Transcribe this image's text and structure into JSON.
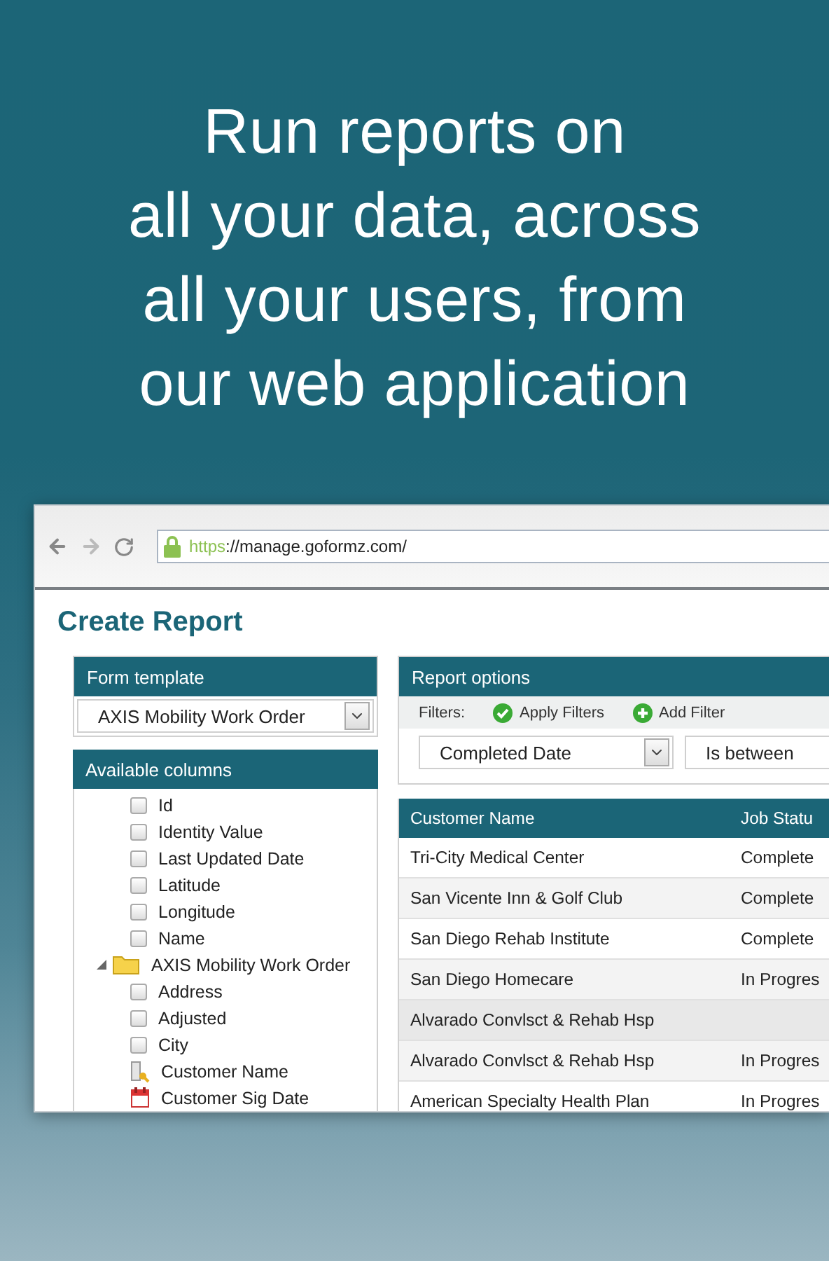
{
  "headline_lines": [
    "Run reports on",
    "all your data, across",
    "all your users, from",
    "our web application"
  ],
  "browser": {
    "url_scheme": "https",
    "url_rest": "://manage.goformz.com/"
  },
  "page_title": "Create Report",
  "form_template": {
    "title": "Form template",
    "value": "AXIS Mobility Work Order"
  },
  "available_columns": {
    "title": "Available columns",
    "items": [
      {
        "kind": "checkbox",
        "label": "Id",
        "checked": false
      },
      {
        "kind": "checkbox",
        "label": "Identity Value",
        "checked": false
      },
      {
        "kind": "checkbox",
        "label": "Last Updated Date",
        "checked": false
      },
      {
        "kind": "checkbox",
        "label": "Latitude",
        "checked": false
      },
      {
        "kind": "checkbox",
        "label": "Longitude",
        "checked": false
      },
      {
        "kind": "checkbox",
        "label": "Name",
        "checked": false
      },
      {
        "kind": "folder",
        "label": "AXIS Mobility Work Order",
        "expanded": true,
        "children": [
          {
            "kind": "checkbox",
            "label": "Address",
            "checked": false
          },
          {
            "kind": "checkbox",
            "label": "Adjusted",
            "checked": false
          },
          {
            "kind": "checkbox",
            "label": "City",
            "checked": false
          },
          {
            "kind": "key-field",
            "label": "Customer Name"
          },
          {
            "kind": "date-field",
            "label": "Customer Sig Date"
          }
        ]
      }
    ]
  },
  "report_options": {
    "title": "Report options",
    "filters_label": "Filters:",
    "apply_label": "Apply Filters",
    "add_label": "Add Filter",
    "field_select": "Completed Date",
    "operator_select": "Is between"
  },
  "table": {
    "columns": [
      "Customer Name",
      "Job Statu"
    ],
    "rows": [
      {
        "kind": "item",
        "cells": [
          "Tri-City Medical Center",
          "Complete"
        ]
      },
      {
        "kind": "item",
        "cells": [
          "San Vicente Inn & Golf Club",
          "Complete"
        ]
      },
      {
        "kind": "item",
        "cells": [
          "San Diego Rehab Institute",
          "Complete"
        ]
      },
      {
        "kind": "item",
        "cells": [
          "San Diego Homecare",
          "In Progres"
        ]
      },
      {
        "kind": "group",
        "cells": [
          "Alvarado Convlsct & Rehab Hsp"
        ]
      },
      {
        "kind": "item",
        "cells": [
          "Alvarado Convlsct & Rehab Hsp",
          "In Progres"
        ]
      },
      {
        "kind": "item",
        "cells": [
          "American Specialty Health Plan",
          "In Progres"
        ]
      }
    ]
  }
}
